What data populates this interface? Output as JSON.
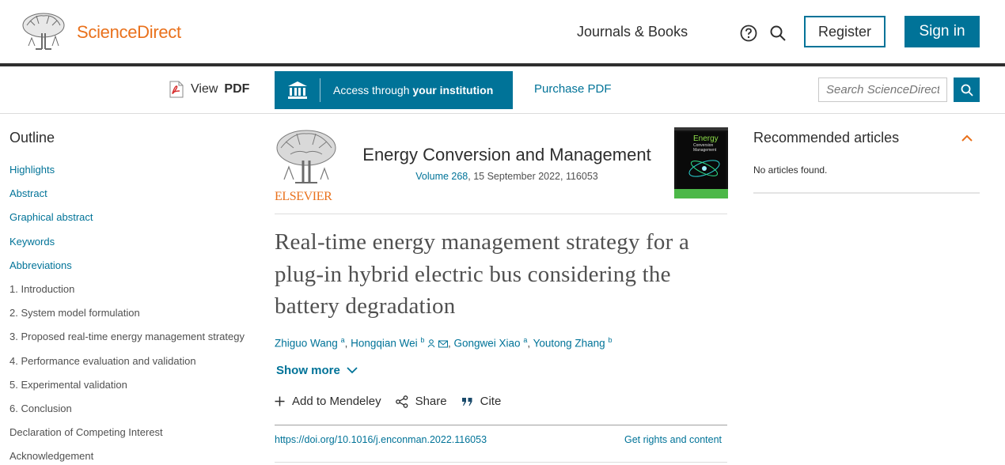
{
  "header": {
    "logo_text": "ScienceDirect",
    "journals_books": "Journals & Books",
    "register_label": "Register",
    "signin_label": "Sign in",
    "help_icon": "question-circle-icon",
    "search_icon": "search-icon"
  },
  "toolbar": {
    "view_pdf_prefix": "View",
    "view_pdf_bold": "PDF",
    "access_prefix": "Access through",
    "access_bold": "your institution",
    "purchase_pdf": "Purchase PDF",
    "search_placeholder": "Search ScienceDirect"
  },
  "outline": {
    "title": "Outline",
    "items": [
      {
        "label": "Highlights",
        "link": true
      },
      {
        "label": "Abstract",
        "link": true
      },
      {
        "label": "Graphical abstract",
        "link": true
      },
      {
        "label": "Keywords",
        "link": true
      },
      {
        "label": "Abbreviations",
        "link": true
      },
      {
        "label": "1. Introduction",
        "link": false
      },
      {
        "label": "2. System model formulation",
        "link": false
      },
      {
        "label": "3. Proposed real-time energy management strategy",
        "link": false
      },
      {
        "label": "4. Performance evaluation and validation",
        "link": false
      },
      {
        "label": "5. Experimental validation",
        "link": false
      },
      {
        "label": "6. Conclusion",
        "link": false
      },
      {
        "label": "Declaration of Competing Interest",
        "link": false
      },
      {
        "label": "Acknowledgement",
        "link": false
      }
    ]
  },
  "article": {
    "publisher_logo_text": "ELSEVIER",
    "journal_name": "Energy Conversion and Management",
    "volume": "Volume 268",
    "issue_info": ", 15 September 2022, 116053",
    "cover_title_line1": "Energy",
    "cover_title_line2": "Conversion",
    "cover_title_line3": "Management",
    "title": "Real-time energy management strategy for a plug-in hybrid electric bus considering the battery degradation",
    "authors": [
      {
        "name": "Zhiguo Wang",
        "sup": "a"
      },
      {
        "name": "Hongqian Wei",
        "sup": "b"
      },
      {
        "name": "Gongwei Xiao",
        "sup": "a"
      },
      {
        "name": "Youtong Zhang",
        "sup": "b"
      }
    ],
    "show_more": "Show more",
    "actions": {
      "mendeley": "Add to Mendeley",
      "share": "Share",
      "cite": "Cite"
    },
    "doi": "https://doi.org/10.1016/j.enconman.2022.116053",
    "rights": "Get rights and content"
  },
  "recommended": {
    "title": "Recommended articles",
    "empty": "No articles found."
  },
  "colors": {
    "brand_orange": "#e9711c",
    "link_blue": "#007398",
    "text_dark": "#2e2e2e"
  }
}
